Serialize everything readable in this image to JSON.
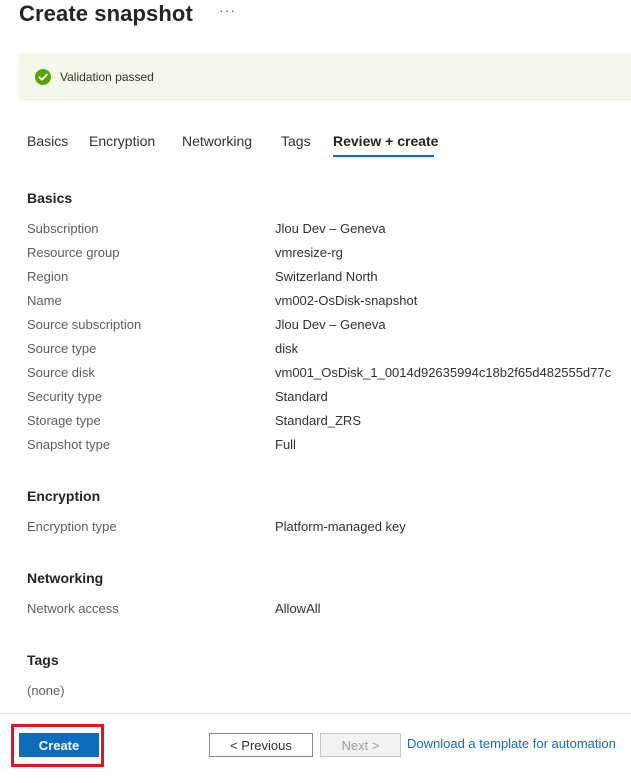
{
  "header": {
    "title": "Create snapshot",
    "more_label": "···"
  },
  "banner": {
    "text": "Validation passed",
    "icon": "checkmark-circle-icon",
    "color": "#57a300"
  },
  "tabs": [
    {
      "label": "Basics"
    },
    {
      "label": "Encryption"
    },
    {
      "label": "Networking"
    },
    {
      "label": "Tags"
    },
    {
      "label": "Review + create",
      "active": true
    }
  ],
  "basics": {
    "title": "Basics",
    "rows": [
      {
        "key": "Subscription",
        "value": "Jlou Dev – Geneva"
      },
      {
        "key": "Resource group",
        "value": "vmresize-rg"
      },
      {
        "key": "Region",
        "value": "Switzerland North"
      },
      {
        "key": "Name",
        "value": "vm002-OsDisk-snapshot"
      },
      {
        "key": "Source subscription",
        "value": "Jlou Dev – Geneva"
      },
      {
        "key": "Source type",
        "value": "disk"
      },
      {
        "key": "Source disk",
        "value": "vm001_OsDisk_1_0014d92635994c18b2f65d482555d77c"
      },
      {
        "key": "Security type",
        "value": "Standard"
      },
      {
        "key": "Storage type",
        "value": "Standard_ZRS"
      },
      {
        "key": "Snapshot type",
        "value": "Full"
      }
    ]
  },
  "encryption": {
    "title": "Encryption",
    "rows": [
      {
        "key": "Encryption type",
        "value": "Platform-managed key"
      }
    ]
  },
  "networking": {
    "title": "Networking",
    "rows": [
      {
        "key": "Network access",
        "value": "AllowAll"
      }
    ]
  },
  "tags": {
    "title": "Tags",
    "value": "(none)"
  },
  "footer": {
    "create_label": "Create",
    "previous_label": "< Previous",
    "next_label": "Next >",
    "download_label": "Download a template for automation"
  },
  "colors": {
    "accent": "#0f6cbd",
    "highlight": "#e81123",
    "banner_bg": "#f3f9ea"
  }
}
